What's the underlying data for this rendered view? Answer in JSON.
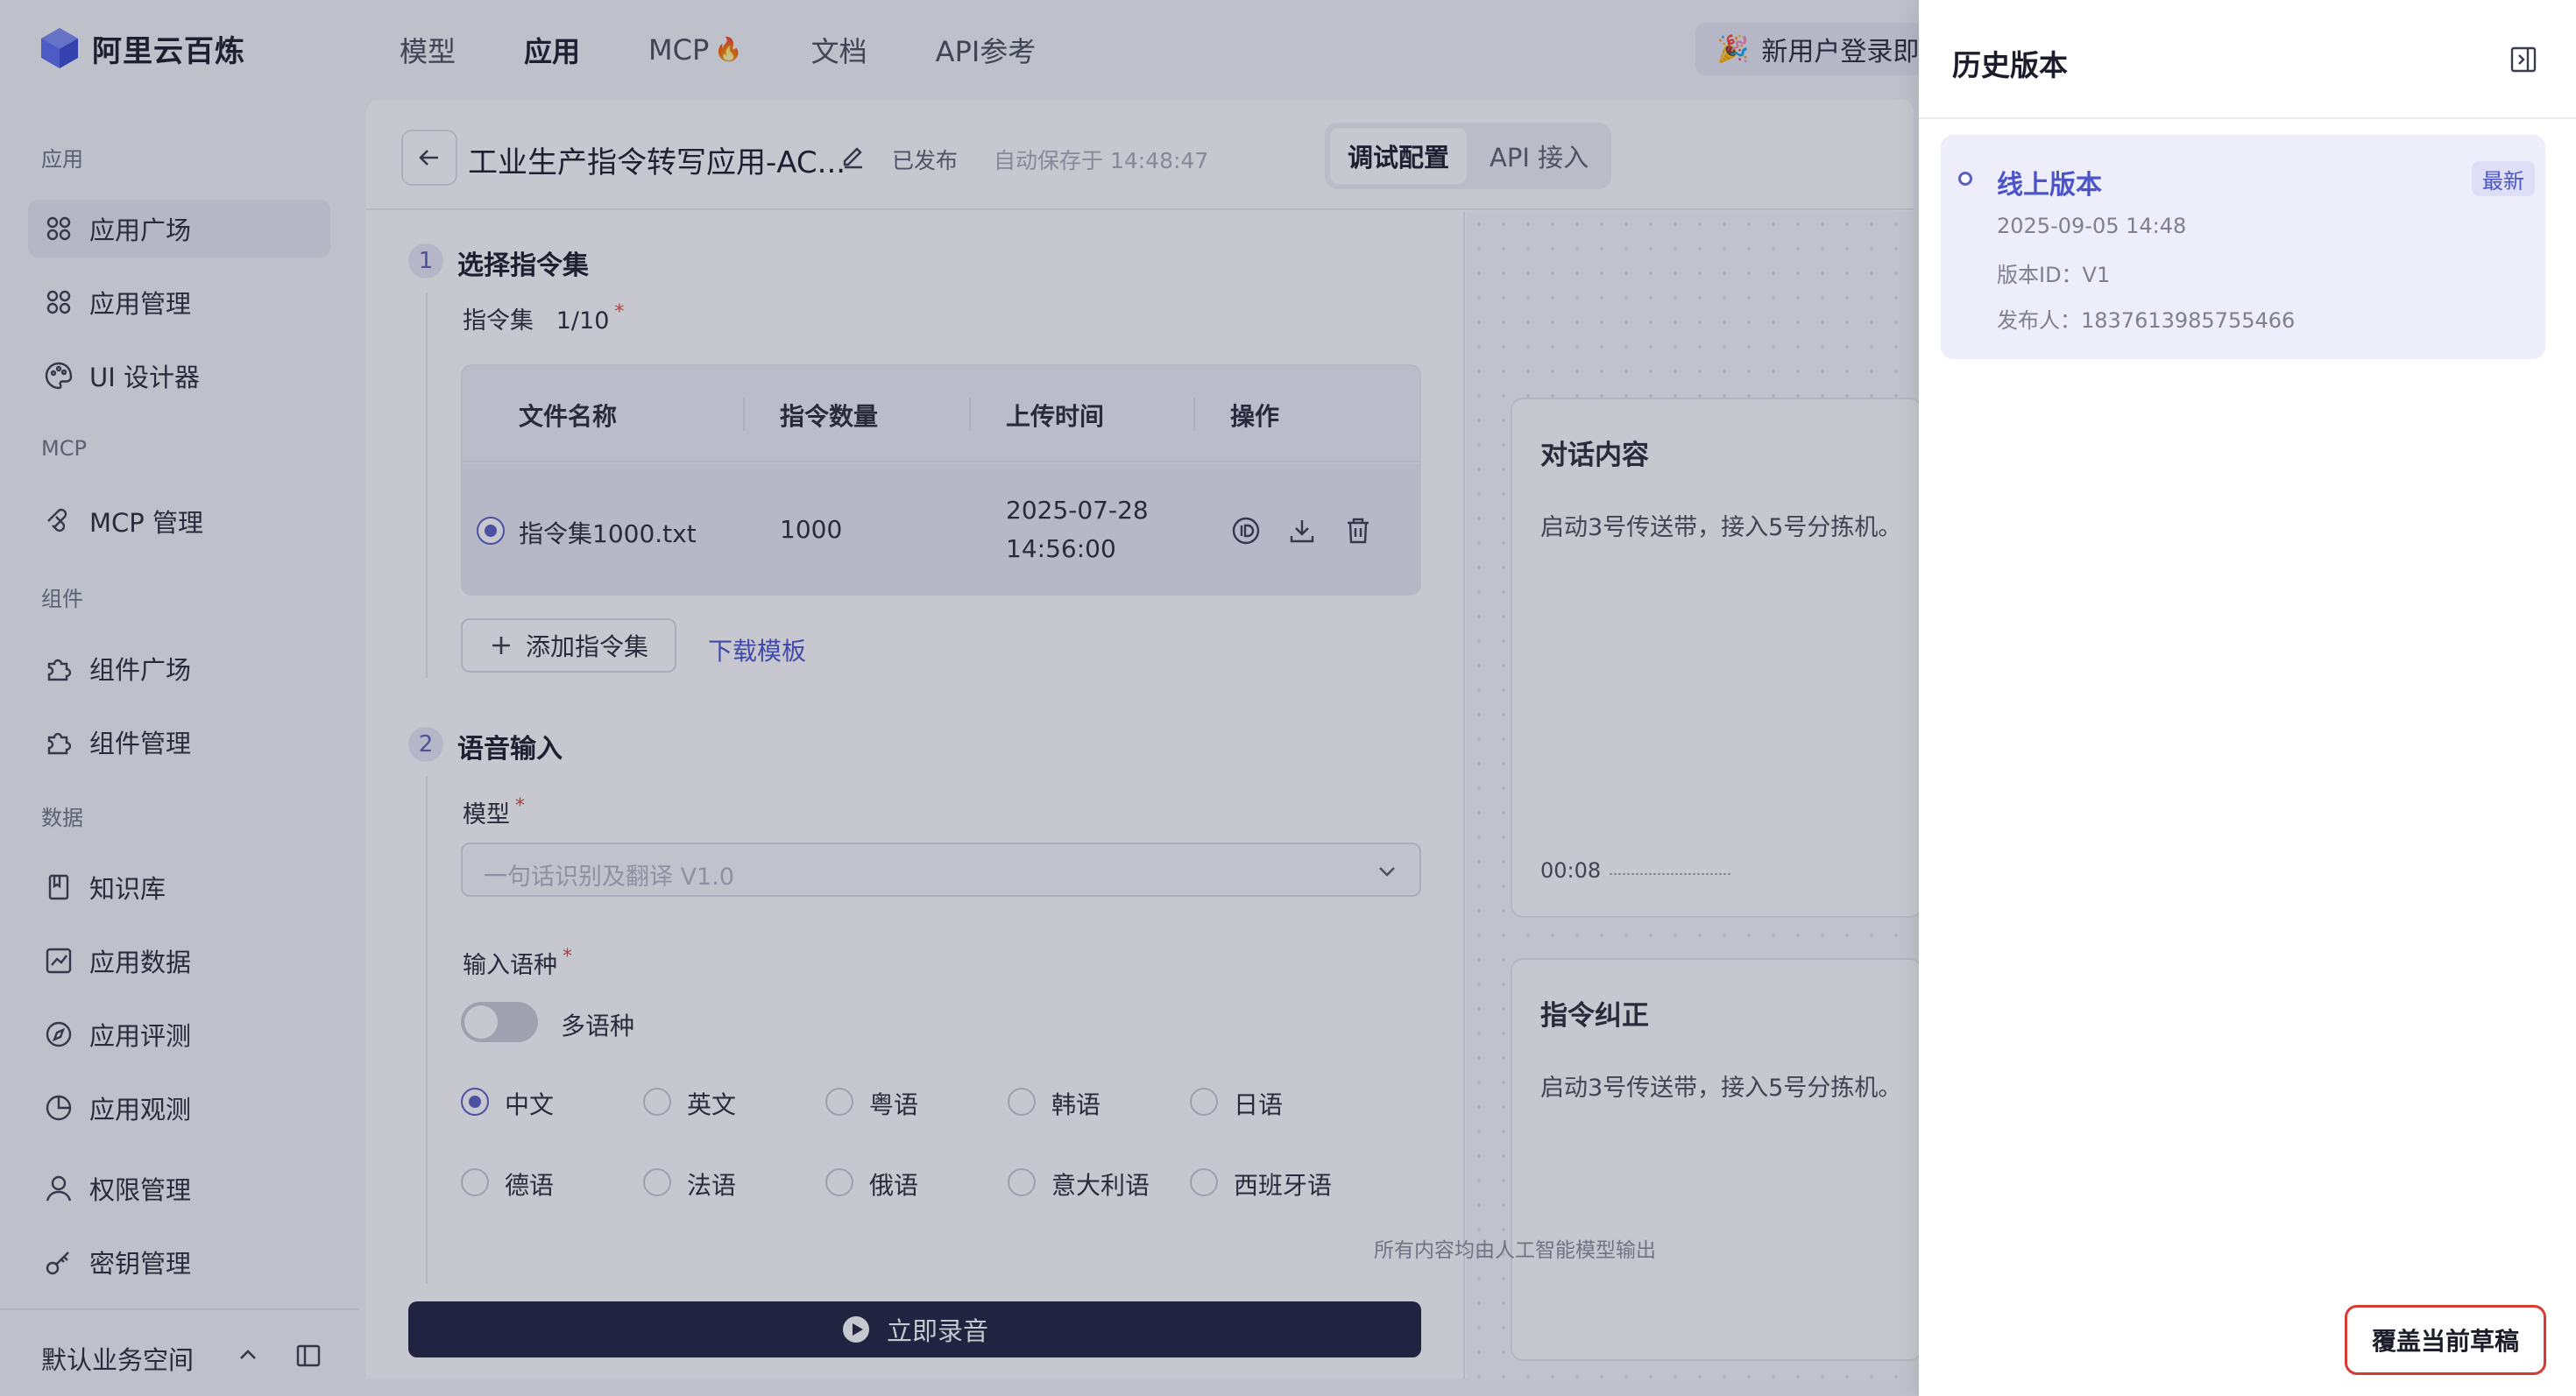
{
  "brand": {
    "name": "阿里云百炼"
  },
  "topnav": [
    {
      "label": "模型"
    },
    {
      "label": "应用"
    },
    {
      "label": "MCP"
    },
    {
      "label": "文档"
    },
    {
      "label": "API参考"
    }
  ],
  "promo": {
    "text": "新用户登录即享"
  },
  "sidebar": {
    "sections": {
      "app": "应用",
      "mcp": "MCP",
      "components": "组件",
      "data": "数据"
    },
    "items": {
      "app_plaza": "应用广场",
      "app_manage": "应用管理",
      "ui_designer": "UI 设计器",
      "mcp_manage": "MCP 管理",
      "comp_plaza": "组件广场",
      "comp_manage": "组件管理",
      "knowledge": "知识库",
      "app_data": "应用数据",
      "app_eval": "应用评测",
      "app_observe": "应用观测",
      "permissions": "权限管理",
      "keys": "密钥管理"
    },
    "workspace": "默认业务空间"
  },
  "header": {
    "title": "工业生产指令转写应用-AC...",
    "status": "已发布",
    "autosave": "自动保存于 14:48:47",
    "tabs": [
      "调试配置",
      "API 接入"
    ]
  },
  "step1": {
    "num": "1",
    "title": "选择指令集",
    "field_label": "指令集",
    "count": "1/10",
    "table": {
      "headers": [
        "文件名称",
        "指令数量",
        "上传时间",
        "操作"
      ],
      "rows": [
        {
          "file": "指令集1000.txt",
          "count": "1000",
          "date": "2025-07-28",
          "time": "14:56:00"
        }
      ]
    },
    "add_label": "添加指令集",
    "template_link": "下载模板"
  },
  "step2": {
    "num": "2",
    "title": "语音输入",
    "model_label": "模型",
    "model_placeholder": "一句话识别及翻译 V1.0",
    "lang_label": "输入语种",
    "multi_label": "多语种",
    "languages": [
      "中文",
      "英文",
      "粤语",
      "韩语",
      "日语",
      "德语",
      "法语",
      "俄语",
      "意大利语",
      "西班牙语"
    ]
  },
  "record_label": "立即录音",
  "preview": {
    "dialog_title": "对话内容",
    "dialog_text": "启动3号传送带，接入5号分拣机。",
    "dialog_time": "00:08",
    "correct_title": "指令纠正",
    "correct_text": "启动3号传送带，接入5号分拣机。",
    "disclaimer": "所有内容均由人工智能模型输出"
  },
  "drawer": {
    "title": "历史版本",
    "version": {
      "name": "线上版本",
      "badge": "最新",
      "date": "2025-09-05 14:48",
      "id_line": "版本ID：V1",
      "publisher_line": "发布人：1837613985755466"
    },
    "overwrite_label": "覆盖当前草稿"
  }
}
